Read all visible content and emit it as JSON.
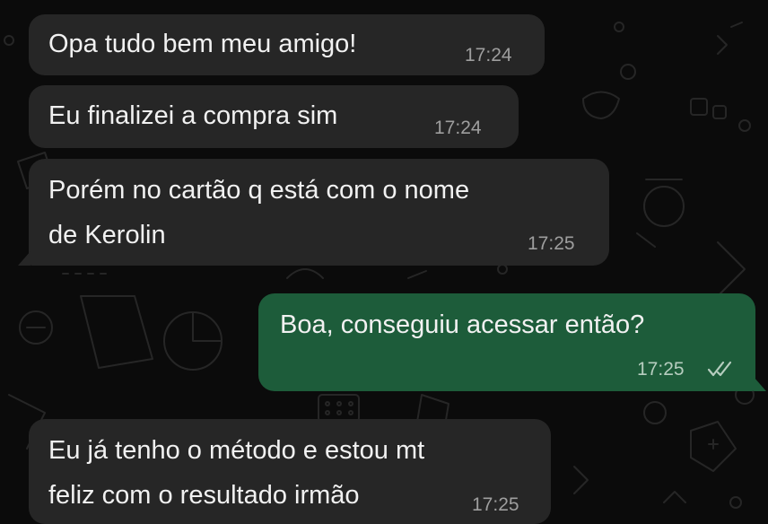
{
  "messages": [
    {
      "direction": "incoming",
      "text": "Opa tudo bem meu amigo!",
      "time": "17:24"
    },
    {
      "direction": "incoming",
      "text": "Eu finalizei a compra sim",
      "time": "17:24"
    },
    {
      "direction": "incoming",
      "text": "Porém no cartão q está com o nome\nde Kerolin",
      "time": "17:25"
    },
    {
      "direction": "outgoing",
      "text": "Boa, conseguiu acessar então?",
      "time": "17:25",
      "status": "read"
    },
    {
      "direction": "incoming",
      "text": "Eu já tenho o método e estou mt\nfeliz com o resultado irmão",
      "time": "17:25"
    }
  ],
  "colors": {
    "background": "#0b0b0b",
    "incoming_bubble": "#262626",
    "outgoing_bubble": "#1d5c3a",
    "text": "#f1f1f1",
    "read_ticks": "#b6cdbf"
  },
  "icons": [
    "double-check-icon"
  ]
}
